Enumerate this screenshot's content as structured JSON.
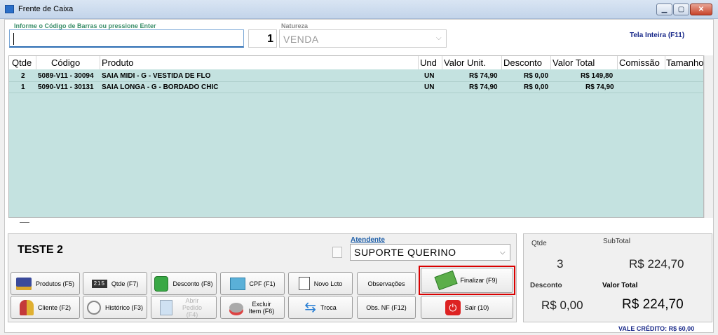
{
  "window": {
    "title": "Frente de Caixa"
  },
  "header": {
    "barcode_label": "Informe o Código de Barras ou pressione Enter",
    "barcode_value": "",
    "quantity": "1",
    "natureza_label": "Natureza",
    "natureza_value": "VENDA",
    "fullscreen": "Tela Inteira (F11)"
  },
  "grid": {
    "columns": [
      "Qtde",
      "Código",
      "Produto",
      "Und",
      "Valor Unit.",
      "Desconto",
      "Valor Total",
      "Comissão",
      "Tamanho"
    ],
    "rows": [
      {
        "qtde": "2",
        "codigo": "5089-V11 - 30094",
        "produto": "SAIA MIDI - G - VESTIDA DE FLO",
        "und": "UN",
        "valor_unit": "R$ 74,90",
        "desconto": "R$ 0,00",
        "valor_total": "R$ 149,80"
      },
      {
        "qtde": "1",
        "codigo": "5090-V11 - 30131",
        "produto": "SAIA LONGA - G - BORDADO CHIC",
        "und": "UN",
        "valor_unit": "R$ 74,90",
        "desconto": "R$ 0,00",
        "valor_total": "R$ 74,90"
      }
    ]
  },
  "customer": {
    "name": "TESTE 2"
  },
  "atendente": {
    "label": "Atendente",
    "value": "SUPORTE QUERINO"
  },
  "buttons": {
    "produtos": "Produtos (F5)",
    "qtde": "Qtde (F7)",
    "desconto": "Desconto (F8)",
    "cpf": "CPF (F1)",
    "novo_lcto": "Novo Lcto",
    "observacoes": "Observações",
    "finalizar": "Finalizar (F9)",
    "cliente": "Cliente (F2)",
    "historico": "Histórico (F3)",
    "abrir_pedido": "Abrir Pedido (F4)",
    "excluir_item": "Excluir Item (F6)",
    "troca": "Troca",
    "obs_nf": "Obs. NF (F12)",
    "sair": "Sair (10)"
  },
  "icons": {
    "qtde_badge": "215"
  },
  "totals": {
    "qtde_label": "Qtde",
    "qtde_value": "3",
    "subtotal_label": "SubTotal",
    "subtotal_value": "R$ 224,70",
    "desconto_label": "Desconto",
    "desconto_value": "R$ 0,00",
    "valor_total_label": "Valor Total",
    "valor_total_value": "R$ 224,70"
  },
  "footer": {
    "vale_credito": "VALE CRÉDITO: R$ 60,00"
  },
  "colors": {
    "grid_bg": "#c4e2e0",
    "accent_label": "#3b8f6a",
    "highlight": "#d90000",
    "link_blue": "#1a2a8a"
  }
}
